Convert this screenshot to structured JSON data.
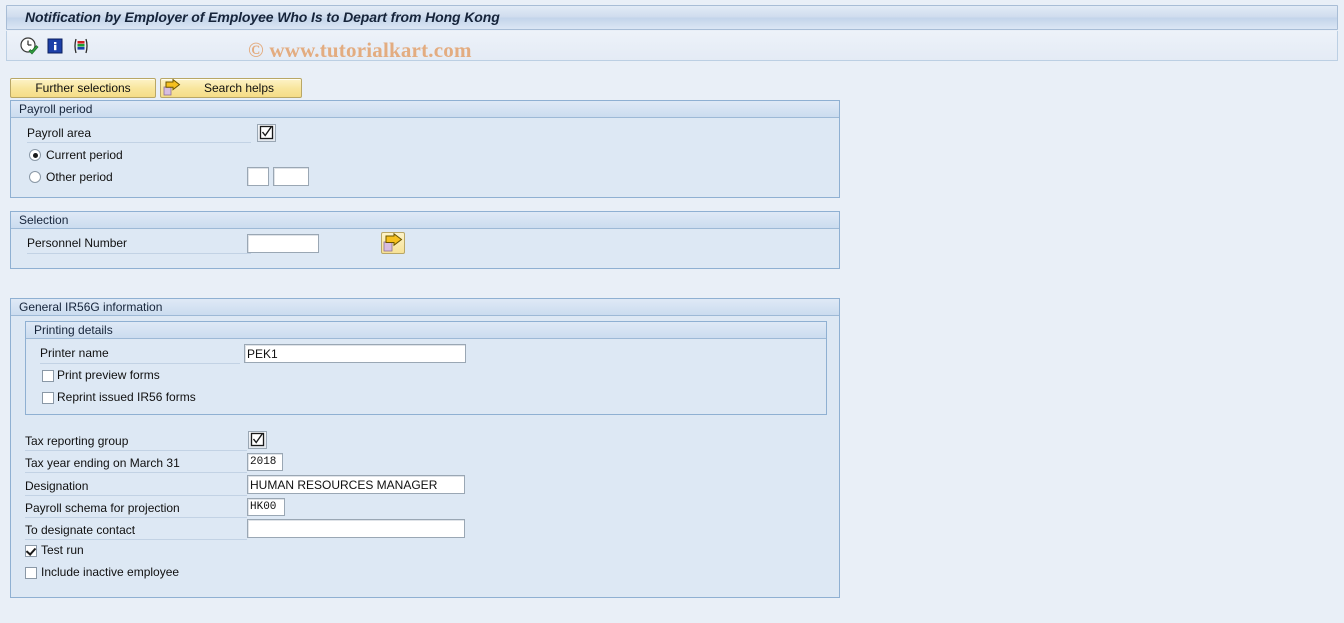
{
  "window": {
    "title": "Notification by Employer of Employee Who Is to Depart from Hong Kong"
  },
  "watermark": {
    "text": "© www.tutorialkart.com"
  },
  "toolbar": {
    "icons": [
      {
        "name": "execute-clock-icon",
        "label": "Execute"
      },
      {
        "name": "info-icon",
        "label": "Information"
      },
      {
        "name": "variant-icon",
        "label": "Get Variant"
      }
    ]
  },
  "buttons": {
    "further_selections": "Further selections",
    "search_helps": "Search helps"
  },
  "payroll_period": {
    "header": "Payroll period",
    "payroll_area_label": "Payroll area",
    "payroll_area_value": "",
    "current_period_label": "Current period",
    "current_period_selected": true,
    "other_period_label": "Other period",
    "other_period_selected": false,
    "other_period_value_1": "",
    "other_period_value_2": ""
  },
  "selection": {
    "header": "Selection",
    "personnel_number_label": "Personnel Number",
    "personnel_number_value": ""
  },
  "general": {
    "header": "General IR56G information",
    "printing": {
      "header": "Printing details",
      "printer_name_label": "Printer name",
      "printer_name_value": "PEK1",
      "print_preview_label": "Print preview forms",
      "print_preview_checked": false,
      "reprint_label": "Reprint issued IR56 forms",
      "reprint_checked": false
    },
    "tax_reporting_group_label": "Tax reporting group",
    "tax_year_label": "Tax year ending on March 31",
    "tax_year_value": "2018",
    "designation_label": "Designation",
    "designation_value": "HUMAN RESOURCES MANAGER",
    "payroll_schema_label": "Payroll schema for projection",
    "payroll_schema_value": "HK00",
    "designate_contact_label": "To designate contact",
    "designate_contact_value": "",
    "test_run_label": "Test run",
    "test_run_checked": true,
    "include_inactive_label": "Include inactive employee",
    "include_inactive_checked": false
  },
  "colors": {
    "background": "#e9eff7",
    "group_fill": "#dde8f4",
    "group_border": "#8fb0d2",
    "button_yellow": "#f8e59b",
    "watermark": "#e3ac80",
    "title_text": "#16243a"
  }
}
